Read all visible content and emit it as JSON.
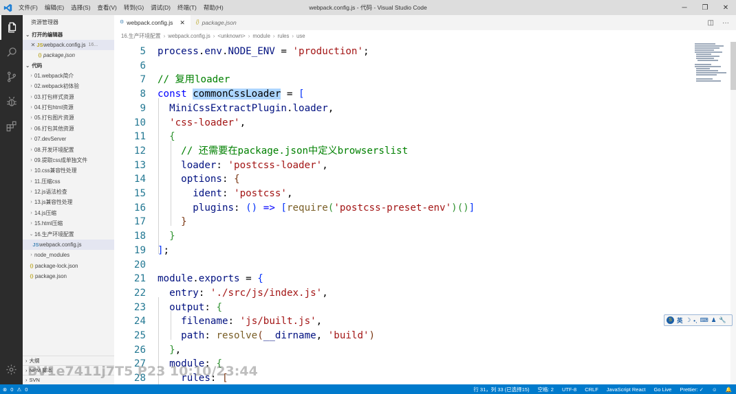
{
  "window": {
    "title": "webpack.config.js - 代码 - Visual Studio Code",
    "menu": [
      "文件(F)",
      "编辑(E)",
      "选择(S)",
      "查看(V)",
      "转到(G)",
      "调试(D)",
      "终端(T)",
      "帮助(H)"
    ],
    "controls": [
      "minimize",
      "restore",
      "close"
    ]
  },
  "activity_bar": {
    "icons": [
      "files-icon",
      "search-icon",
      "source-control-icon",
      "debug-icon",
      "extensions-icon"
    ],
    "bottom_icon": "settings-gear-icon"
  },
  "sidebar": {
    "header": "资源管理器",
    "open_editors": {
      "label": "打开的编辑器",
      "items": [
        {
          "name": "webpack.config.js",
          "suffix": "16...",
          "active": true,
          "closable": true
        },
        {
          "name": "package.json",
          "suffix": "",
          "italic": true
        }
      ]
    },
    "folder": {
      "label": "代码",
      "items": [
        {
          "name": "01.webpack简介",
          "type": "folder"
        },
        {
          "name": "02.webpack初体验",
          "type": "folder"
        },
        {
          "name": "03.打包样式资源",
          "type": "folder"
        },
        {
          "name": "04.打包html资源",
          "type": "folder"
        },
        {
          "name": "05.打包图片资源",
          "type": "folder"
        },
        {
          "name": "06.打包其他资源",
          "type": "folder"
        },
        {
          "name": "07.devServer",
          "type": "folder"
        },
        {
          "name": "08.开发环境配置",
          "type": "folder"
        },
        {
          "name": "09.提取css成单独文件",
          "type": "folder"
        },
        {
          "name": "10.css兼容性处理",
          "type": "folder"
        },
        {
          "name": "11.压缩css",
          "type": "folder"
        },
        {
          "name": "12.js语法检查",
          "type": "folder"
        },
        {
          "name": "13.js兼容性处理",
          "type": "folder"
        },
        {
          "name": "14.js压缩",
          "type": "folder"
        },
        {
          "name": "15.html压缩",
          "type": "folder"
        },
        {
          "name": "16.生产环境配置",
          "type": "folder-open"
        },
        {
          "name": "webpack.config.js",
          "type": "file",
          "active": true
        },
        {
          "name": "node_modules",
          "type": "folder"
        },
        {
          "name": "package-lock.json",
          "type": "json"
        },
        {
          "name": "package.json",
          "type": "json"
        }
      ]
    },
    "bottom_sections": [
      "大纲",
      "NPM 脚本",
      "SVN"
    ]
  },
  "tabs": [
    {
      "label": "webpack.config.js",
      "active": true
    },
    {
      "label": "package.json",
      "active": false
    }
  ],
  "breadcrumb": [
    "16.生产环境配置",
    "webpack.config.js",
    "<unknown>",
    "module",
    "rules",
    "use"
  ],
  "editor": {
    "lines": [
      {
        "n": "5",
        "tokens": [
          [
            "prop",
            "process"
          ],
          [
            "",
            "."
          ],
          [
            "prop",
            "env"
          ],
          [
            "",
            "."
          ],
          [
            "prop",
            "NODE_ENV"
          ],
          [
            "",
            " = "
          ],
          [
            "str",
            "'production'"
          ],
          [
            "",
            ";"
          ]
        ]
      },
      {
        "n": "6",
        "tokens": []
      },
      {
        "n": "7",
        "tokens": [
          [
            "cm",
            "// 复用loader"
          ]
        ]
      },
      {
        "n": "8",
        "tokens": [
          [
            "kw",
            "const"
          ],
          [
            "",
            " "
          ],
          [
            "sel",
            "commonCssLoader"
          ],
          [
            "",
            " = "
          ],
          [
            "br1",
            "["
          ]
        ]
      },
      {
        "n": "9",
        "tokens": [
          [
            "",
            "  "
          ],
          [
            "prop",
            "MiniCssExtractPlugin"
          ],
          [
            "",
            "."
          ],
          [
            "prop",
            "loader"
          ],
          [
            "",
            ","
          ]
        ]
      },
      {
        "n": "10",
        "tokens": [
          [
            "",
            "  "
          ],
          [
            "str",
            "'css-loader'"
          ],
          [
            "",
            ","
          ]
        ]
      },
      {
        "n": "11",
        "tokens": [
          [
            "",
            "  "
          ],
          [
            "br2",
            "{"
          ]
        ]
      },
      {
        "n": "12",
        "tokens": [
          [
            "",
            "    "
          ],
          [
            "cm",
            "// 还需要在package.json中定义browserslist"
          ]
        ]
      },
      {
        "n": "13",
        "tokens": [
          [
            "",
            "    "
          ],
          [
            "prop",
            "loader"
          ],
          [
            "",
            ": "
          ],
          [
            "str",
            "'postcss-loader'"
          ],
          [
            "",
            ","
          ]
        ]
      },
      {
        "n": "14",
        "tokens": [
          [
            "",
            "    "
          ],
          [
            "prop",
            "options"
          ],
          [
            "",
            ": "
          ],
          [
            "br3",
            "{"
          ]
        ]
      },
      {
        "n": "15",
        "tokens": [
          [
            "",
            "      "
          ],
          [
            "prop",
            "ident"
          ],
          [
            "",
            ": "
          ],
          [
            "str",
            "'postcss'"
          ],
          [
            "",
            ","
          ]
        ]
      },
      {
        "n": "16",
        "tokens": [
          [
            "",
            "      "
          ],
          [
            "prop",
            "plugins"
          ],
          [
            "",
            ": "
          ],
          [
            "br1",
            "()"
          ],
          [
            "",
            " "
          ],
          [
            "kw",
            "=>"
          ],
          [
            "",
            " "
          ],
          [
            "br1",
            "["
          ],
          [
            "fn",
            "require"
          ],
          [
            "br2",
            "("
          ],
          [
            "str",
            "'postcss-preset-env'"
          ],
          [
            "br2",
            ")"
          ],
          [
            "br2",
            "()"
          ],
          [
            "br1",
            "]"
          ]
        ]
      },
      {
        "n": "17",
        "tokens": [
          [
            "",
            "    "
          ],
          [
            "br3",
            "}"
          ]
        ]
      },
      {
        "n": "18",
        "tokens": [
          [
            "",
            "  "
          ],
          [
            "br2",
            "}"
          ]
        ]
      },
      {
        "n": "19",
        "tokens": [
          [
            "br1",
            "]"
          ],
          [
            "",
            ";"
          ]
        ]
      },
      {
        "n": "20",
        "tokens": []
      },
      {
        "n": "21",
        "tokens": [
          [
            "prop",
            "module"
          ],
          [
            "",
            "."
          ],
          [
            "prop",
            "exports"
          ],
          [
            "",
            " = "
          ],
          [
            "br1",
            "{"
          ]
        ]
      },
      {
        "n": "22",
        "tokens": [
          [
            "",
            "  "
          ],
          [
            "prop",
            "entry"
          ],
          [
            "",
            ": "
          ],
          [
            "str",
            "'./src/js/index.js'"
          ],
          [
            "",
            ","
          ]
        ]
      },
      {
        "n": "23",
        "tokens": [
          [
            "",
            "  "
          ],
          [
            "prop",
            "output"
          ],
          [
            "",
            ": "
          ],
          [
            "br2",
            "{"
          ]
        ]
      },
      {
        "n": "24",
        "tokens": [
          [
            "",
            "    "
          ],
          [
            "prop",
            "filename"
          ],
          [
            "",
            ": "
          ],
          [
            "str",
            "'js/built.js'"
          ],
          [
            "",
            ","
          ]
        ]
      },
      {
        "n": "25",
        "tokens": [
          [
            "",
            "    "
          ],
          [
            "prop",
            "path"
          ],
          [
            "",
            ": "
          ],
          [
            "fn",
            "resolve"
          ],
          [
            "br3",
            "("
          ],
          [
            "prop",
            "__dirname"
          ],
          [
            "",
            ", "
          ],
          [
            "str",
            "'build'"
          ],
          [
            "br3",
            ")"
          ]
        ]
      },
      {
        "n": "26",
        "tokens": [
          [
            "",
            "  "
          ],
          [
            "br2",
            "}"
          ],
          [
            "",
            ","
          ]
        ]
      },
      {
        "n": "27",
        "tokens": [
          [
            "",
            "  "
          ],
          [
            "prop",
            "module"
          ],
          [
            "",
            ": "
          ],
          [
            "br2",
            "{"
          ]
        ]
      },
      {
        "n": "28",
        "tokens": [
          [
            "",
            "    "
          ],
          [
            "prop",
            "rules"
          ],
          [
            "",
            ": "
          ],
          [
            "br3",
            "["
          ]
        ]
      }
    ]
  },
  "ime_toolbar": {
    "items": [
      "英",
      "☽",
      "•,",
      "⌨",
      "♟",
      "🔧"
    ]
  },
  "watermark": "BV1e7411j7T5 P23 10:10/23:44",
  "status_bar": {
    "left": {
      "errors": "0",
      "warnings": "0"
    },
    "right": [
      "行 31，列 33 (已选择15)",
      "空格: 2",
      "UTF-8",
      "CRLF",
      "JavaScript React",
      "Go Live",
      "Prettier: ✓"
    ],
    "icons": [
      "smiley-icon",
      "bell-icon"
    ]
  },
  "colors": {
    "status_bar": "#007acc",
    "activity_bar": "#2c2c2c",
    "selection": "#add6ff",
    "comment": "#008000",
    "keyword": "#0000ff",
    "string": "#a31515"
  }
}
